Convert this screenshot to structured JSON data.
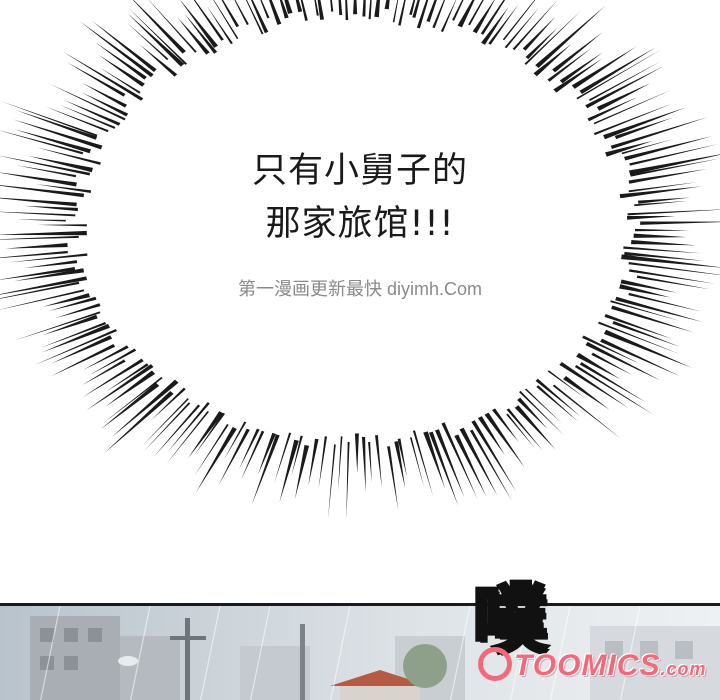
{
  "speech_bubble": {
    "line1": "只有小舅子的",
    "line2": "那家旅馆!!!"
  },
  "watermark": "第一漫画更新最快 diyimh.Com",
  "sound_effect": "噗",
  "logo": {
    "brand": "TOOMICS",
    "suffix": ".com",
    "color": "#f06a7c"
  },
  "colors": {
    "ink": "#1a1a1a",
    "sky": "#dfe4e8"
  }
}
